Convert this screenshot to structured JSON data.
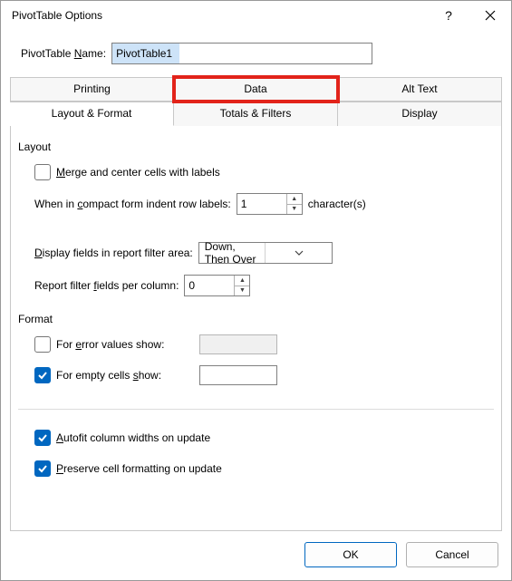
{
  "title": "PivotTable Options",
  "name_label_pre": "PivotTable ",
  "name_label_ul": "N",
  "name_label_post": "ame:",
  "name_value": "PivotTable1",
  "tabs_row1": {
    "printing": "Printing",
    "data": "Data",
    "alttext": "Alt Text"
  },
  "tabs_row2": {
    "layout": "Layout & Format",
    "totals": "Totals & Filters",
    "display": "Display"
  },
  "layout": {
    "title": "Layout",
    "merge_ul": "M",
    "merge_rest": "erge and center cells with labels",
    "merge_checked": false,
    "compact_pre": "When in ",
    "compact_ul": "c",
    "compact_post": "ompact form indent row labels:",
    "indent_value": "1",
    "characters": "character(s)",
    "display_fields_ul": "D",
    "display_fields_rest": "isplay fields in report filter area:",
    "display_fields_value": "Down, Then Over",
    "report_filter_pre": "Report filter ",
    "report_filter_ul": "f",
    "report_filter_post": "ields per column:",
    "report_filter_value": "0"
  },
  "format": {
    "title": "Format",
    "error_pre": "For ",
    "error_ul": "e",
    "error_post": "rror values show:",
    "error_checked": false,
    "empty_pre": "For empty cells ",
    "empty_ul": "s",
    "empty_post": "how:",
    "empty_checked": true,
    "autofit_ul": "A",
    "autofit_rest": "utofit column widths on update",
    "autofit_checked": true,
    "preserve_ul": "P",
    "preserve_rest": "reserve cell formatting on update",
    "preserve_checked": true
  },
  "buttons": {
    "ok": "OK",
    "cancel": "Cancel"
  }
}
